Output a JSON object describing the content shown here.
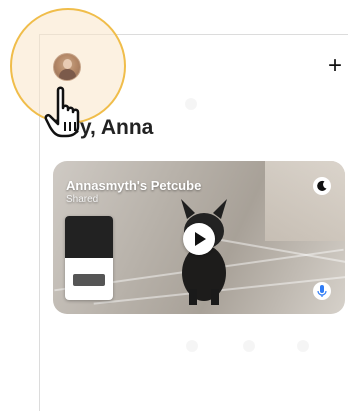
{
  "header": {
    "add_label": "+",
    "greeting": "Hey, Anna"
  },
  "camera": {
    "name": "Annasmyth's Petcube",
    "status": "Shared"
  },
  "icons": {
    "avatar": "avatar",
    "add": "plus-icon",
    "cursor": "hand-pointer-icon",
    "night": "moon-icon",
    "play": "play-icon",
    "mic": "microphone-icon"
  },
  "colors": {
    "highlight_ring": "#f0bd4a",
    "highlight_fill": "#f9e6c8",
    "mic_accent": "#2f7cf6",
    "text_primary": "#222222"
  }
}
